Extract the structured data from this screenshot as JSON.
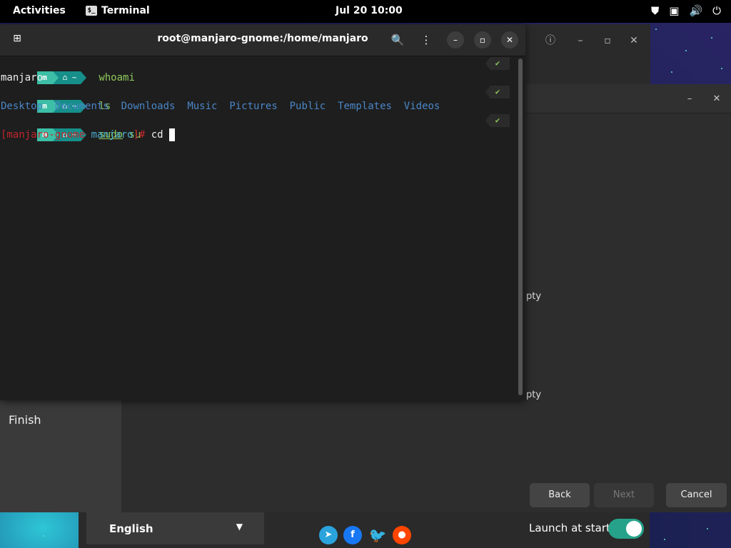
{
  "topbar": {
    "activities": "Activities",
    "app_name": "Terminal",
    "app_icon_text": "$_",
    "clock": "Jul 20  10:00",
    "tray_icons": [
      "shield-icon",
      "keyboard-icon",
      "volume-icon",
      "power-icon"
    ]
  },
  "terminal": {
    "title": "root@manjaro-gnome:/home/manjaro",
    "prompt_home": "~",
    "lines": {
      "cmd1": "whoami",
      "out1": "manjaro",
      "cmd2": "ls",
      "dirs": [
        "Desktop",
        "Documents",
        "Downloads",
        "Music",
        "Pictures",
        "Public",
        "Templates",
        "Videos"
      ],
      "cmd3_a": "sudo",
      "cmd3_b": " su",
      "root_prompt_host": "[manjaro-gnome",
      "root_prompt_dir": "manjaro",
      "root_prompt_end": "]#",
      "root_cmd": " cd "
    },
    "check_mark": "✔"
  },
  "installer": {
    "empty_1": "pty",
    "empty_2": "pty",
    "sidebar_finish": "Finish",
    "buttons": {
      "back": "Back",
      "next": "Next",
      "cancel": "Cancel"
    },
    "language": "English",
    "launch_at_start": "Launch at start",
    "launch_enabled": true
  },
  "colors": {
    "accent": "#26a28a",
    "manjaro_green": "#3cbfa6",
    "dir_blue": "#4a86c7",
    "cmd_green": "#8ec85a",
    "root_red": "#c0262d"
  }
}
